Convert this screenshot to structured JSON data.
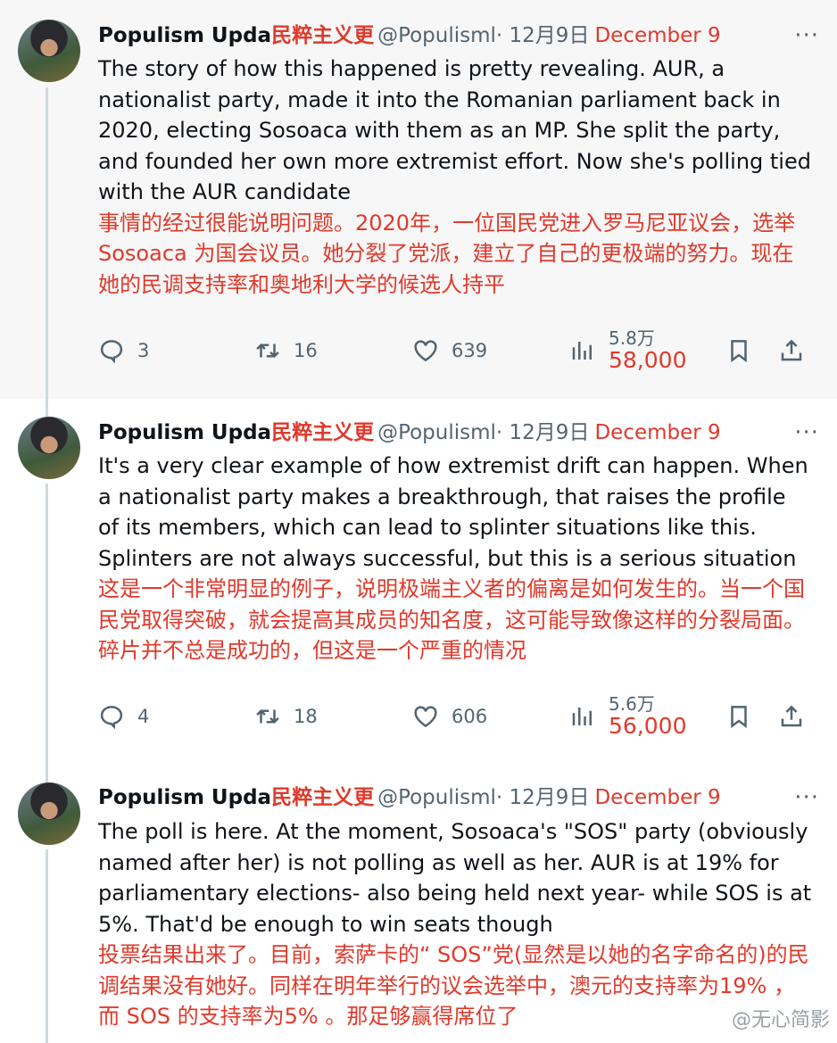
{
  "author": {
    "name": "Populism Upda",
    "name_cn": "民粹主义更",
    "handle": "@Populisml",
    "date": "· 12月9日",
    "date_en": "December 9",
    "more": "···"
  },
  "tweets": [
    {
      "text_en": "The story of how this happened is pretty revealing. AUR, a nationalist party, made it into the Romanian parliament back in 2020, electing Sosoaca with them as an MP. She split the party, and founded her own more extremist effort. Now she's polling tied with the AUR candidate",
      "text_cn": "事情的经过很能说明问题。2020年，一位国民党进入罗马尼亚议会，选举 Sosoaca 为国会议员。她分裂了党派，建立了自己的更极端的努力。现在她的民调支持率和奥地利大学的候选人持平",
      "replies": "3",
      "retweets": "16",
      "likes": "639",
      "views_cn": "5.8万",
      "views_en": "58,000"
    },
    {
      "text_en": "It's a very clear example of how extremist drift can happen. When a nationalist party makes a breakthrough, that raises the profile of its members, which can lead to splinter situations like this. Splinters are not always successful, but this is a serious situation",
      "text_cn": "这是一个非常明显的例子，说明极端主义者的偏离是如何发生的。当一个国民党取得突破，就会提高其成员的知名度，这可能导致像这样的分裂局面。碎片并不总是成功的，但这是一个严重的情况",
      "replies": "4",
      "retweets": "18",
      "likes": "606",
      "views_cn": "5.6万",
      "views_en": "56,000"
    },
    {
      "text_en": "The poll is here. At the moment, Sosoaca's \"SOS\" party (obviously named after her) is not polling as well as her. AUR is at 19% for parliamentary elections- also being held next year- while SOS is at 5%. That'd be enough to win seats though",
      "text_cn": "投票结果出来了。目前，索萨卡的“ SOS”党(显然是以她的名字命名的)的民调结果没有她好。同样在明年举行的议会选举中，澳元的支持率为19% ，而 SOS 的支持率为5% 。那足够赢得席位了"
    }
  ],
  "watermark": "@无心简影"
}
